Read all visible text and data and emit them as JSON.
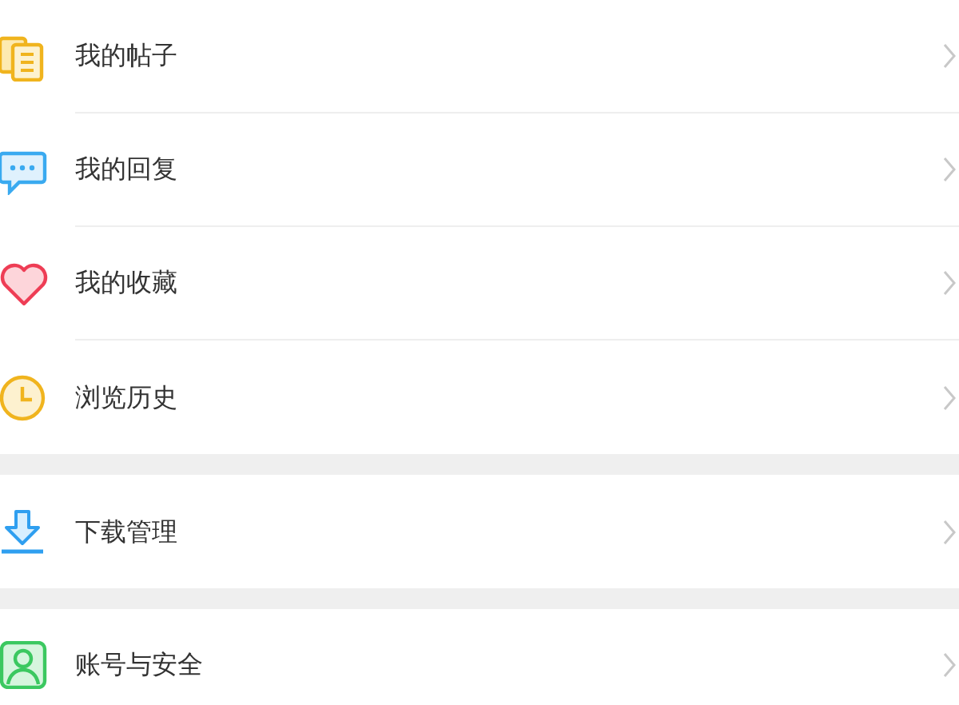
{
  "groups": [
    {
      "items": [
        {
          "kind": "posts",
          "label": "我的帖子"
        },
        {
          "kind": "replies",
          "label": "我的回复"
        },
        {
          "kind": "favorites",
          "label": "我的收藏"
        },
        {
          "kind": "history",
          "label": "浏览历史"
        }
      ]
    },
    {
      "items": [
        {
          "kind": "downloads",
          "label": "下载管理"
        }
      ]
    },
    {
      "items": [
        {
          "kind": "account",
          "label": "账号与安全"
        }
      ]
    }
  ]
}
